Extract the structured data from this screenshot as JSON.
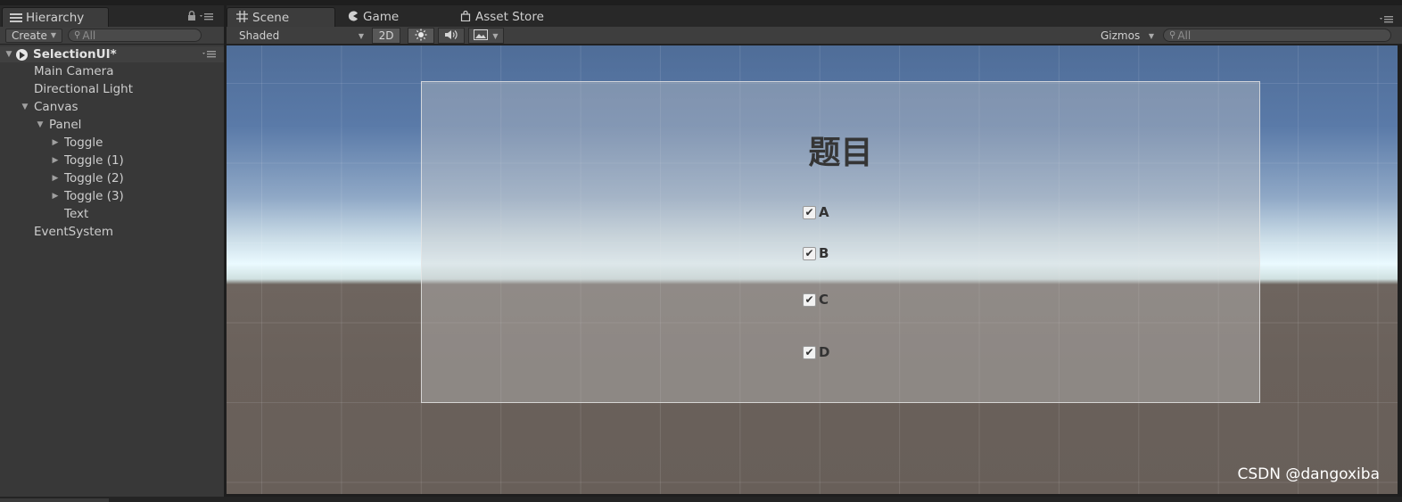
{
  "hierarchy": {
    "tab_label": "Hierarchy",
    "create_label": "Create",
    "search_placeholder": "All",
    "scene_name": "SelectionUI*",
    "items": [
      {
        "label": "Main Camera",
        "indent": 1,
        "arrow": ""
      },
      {
        "label": "Directional Light",
        "indent": 1,
        "arrow": ""
      },
      {
        "label": "Canvas",
        "indent": 1,
        "arrow": "▼"
      },
      {
        "label": "Panel",
        "indent": 2,
        "arrow": "▼"
      },
      {
        "label": "Toggle",
        "indent": 3,
        "arrow": "▶"
      },
      {
        "label": "Toggle (1)",
        "indent": 3,
        "arrow": "▶"
      },
      {
        "label": "Toggle (2)",
        "indent": 3,
        "arrow": "▶"
      },
      {
        "label": "Toggle (3)",
        "indent": 3,
        "arrow": "▶"
      },
      {
        "label": "Text",
        "indent": 3,
        "arrow": ""
      },
      {
        "label": "EventSystem",
        "indent": 1,
        "arrow": ""
      }
    ]
  },
  "tabs": {
    "scene": "Scene",
    "game": "Game",
    "asset_store": "Asset Store"
  },
  "scene_toolbar": {
    "shading": "Shaded",
    "mode_2d": "2D",
    "gizmos": "Gizmos",
    "search_placeholder": "All"
  },
  "scene_view": {
    "question": "题目",
    "options": [
      {
        "label": "A",
        "checked": true
      },
      {
        "label": "B",
        "checked": true
      },
      {
        "label": "C",
        "checked": true
      },
      {
        "label": "D",
        "checked": true
      }
    ]
  },
  "watermark": "CSDN @dangoxiba",
  "icons": {
    "hierarchy": "list-icon",
    "scene": "grid-icon",
    "game": "pacman-icon",
    "asset_store": "bag-icon",
    "lock": "lock-icon",
    "menu": "panel-menu-icon",
    "search": "search-icon",
    "light": "sun-icon",
    "audio": "speaker-icon",
    "effects": "image-icon"
  }
}
